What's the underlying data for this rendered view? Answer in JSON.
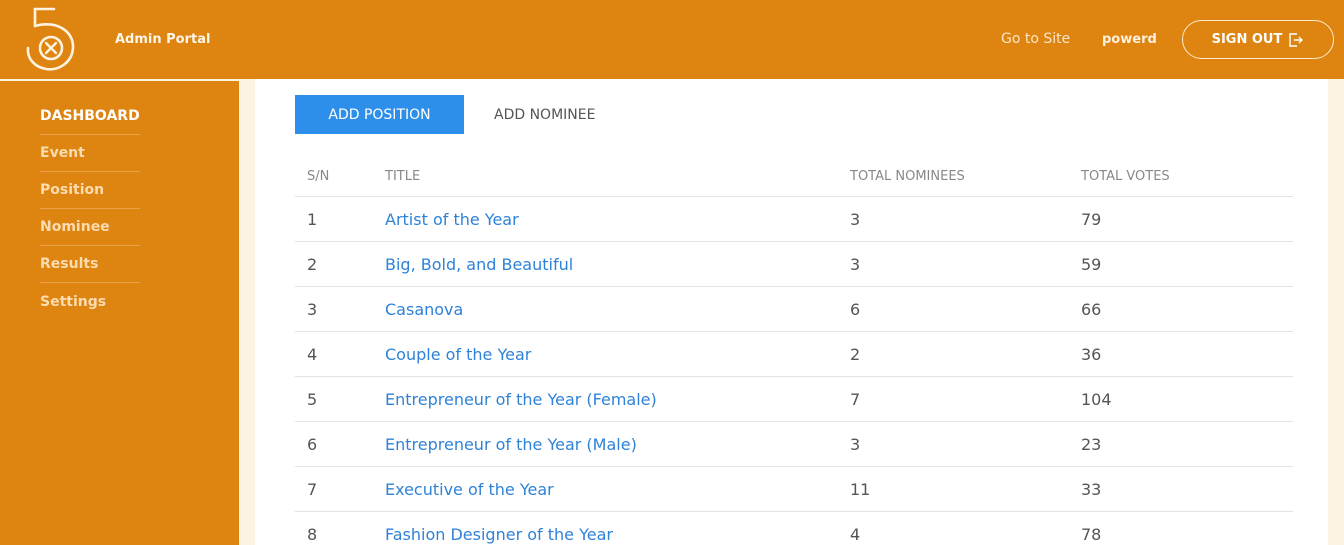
{
  "header": {
    "portal_title": "Admin Portal",
    "go_to_site": "Go to Site",
    "username": "powerd",
    "sign_out": "SIGN OUT"
  },
  "sidebar": {
    "items": [
      {
        "label": "DASHBOARD",
        "active": true
      },
      {
        "label": "Event"
      },
      {
        "label": "Position"
      },
      {
        "label": "Nominee"
      },
      {
        "label": "Results"
      },
      {
        "label": "Settings"
      }
    ]
  },
  "actions": {
    "add_position": "ADD POSITION",
    "add_nominee": "ADD NOMINEE"
  },
  "table": {
    "headers": {
      "sn": "S/N",
      "title": "TITLE",
      "total_nominees": "TOTAL NOMINEES",
      "total_votes": "TOTAL VOTES"
    },
    "rows": [
      {
        "sn": "1",
        "title": "Artist of the Year",
        "nominees": "3",
        "votes": "79"
      },
      {
        "sn": "2",
        "title": "Big, Bold, and Beautiful",
        "nominees": "3",
        "votes": "59"
      },
      {
        "sn": "3",
        "title": "Casanova",
        "nominees": "6",
        "votes": "66"
      },
      {
        "sn": "4",
        "title": "Couple of the Year",
        "nominees": "2",
        "votes": "36"
      },
      {
        "sn": "5",
        "title": "Entrepreneur of the Year (Female)",
        "nominees": "7",
        "votes": "104"
      },
      {
        "sn": "6",
        "title": "Entrepreneur of the Year (Male)",
        "nominees": "3",
        "votes": "23"
      },
      {
        "sn": "7",
        "title": "Executive of the Year",
        "nominees": "11",
        "votes": "33"
      },
      {
        "sn": "8",
        "title": "Fashion Designer of the Year",
        "nominees": "4",
        "votes": "78"
      }
    ]
  },
  "colors": {
    "brand_orange": "#de8410",
    "primary_blue": "#2e8fea",
    "link_blue": "#2e82d8"
  }
}
